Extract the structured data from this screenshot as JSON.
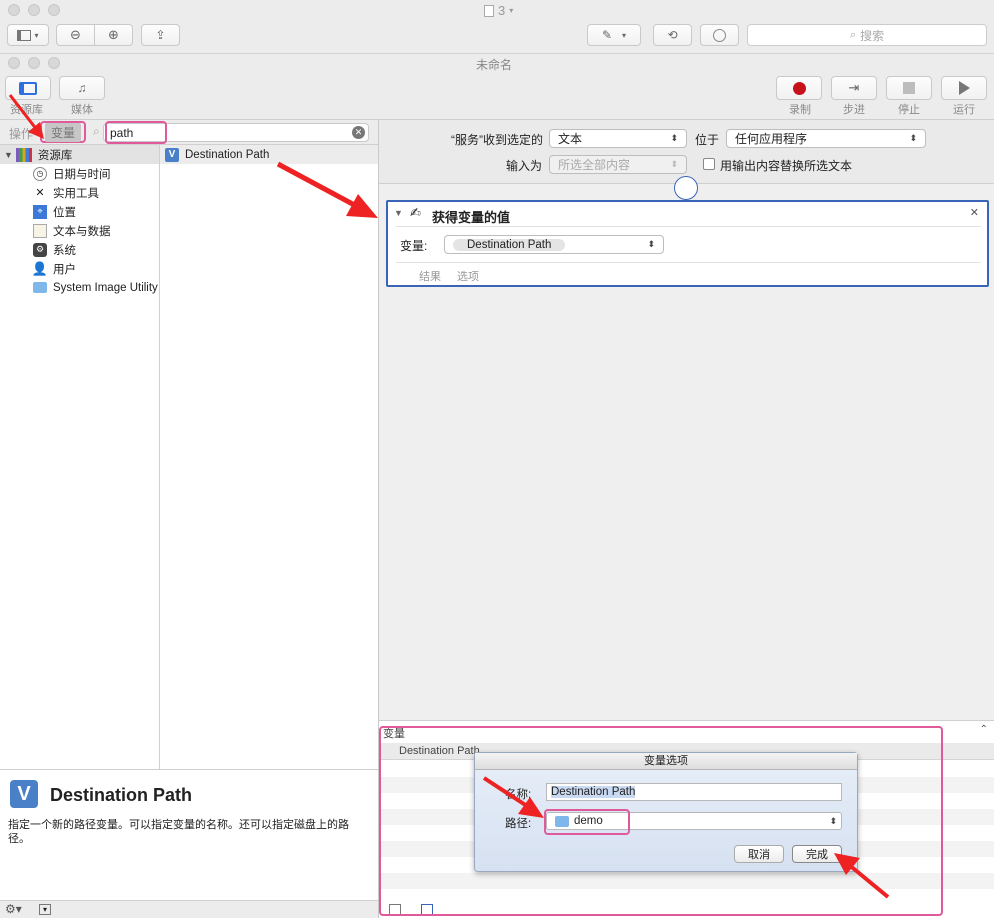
{
  "app": {
    "top_window_title": "3",
    "search_placeholder": "搜索",
    "doc_title": "未命名"
  },
  "toolbar": {
    "library_label": "资源库",
    "media_label": "媒体",
    "record_label": "录制",
    "step_label": "步进",
    "stop_label": "停止",
    "run_label": "运行",
    "record_color": "#c8101a"
  },
  "library": {
    "tab_actions": "操作",
    "tab_variables": "变量",
    "search_value": "path",
    "root": "资源库",
    "items": [
      "日期与时间",
      "实用工具",
      "位置",
      "文本与数据",
      "系统",
      "用户",
      "System Image Utility"
    ],
    "result": "Destination Path"
  },
  "description": {
    "title": "Destination Path",
    "text": "指定一个新的路径变量。可以指定变量的名称。还可以指定磁盘上的路径。"
  },
  "workflow": {
    "service_receives_label": "“服务”收到选定的",
    "input_type": "文本",
    "located_in_label": "位于",
    "app_value": "任何应用程序",
    "input_is_label": "输入为",
    "input_is_value": "所选全部内容",
    "replace_label": "用输出内容替换所选文本",
    "action_title": "获得变量的值",
    "variable_label": "变量:",
    "variable_value": "Destination Path",
    "results_tab": "结果",
    "options_tab": "选项"
  },
  "variables_panel": {
    "header": "变量",
    "column": "Destination Path"
  },
  "sheet": {
    "title": "变量选项",
    "name_label": "名称:",
    "name_value": "Destination Path",
    "path_label": "路径:",
    "path_value": "demo",
    "cancel": "取消",
    "done": "完成"
  },
  "colors": {
    "highlight": "#e05a9b",
    "arrow": "#ee2222",
    "action_border": "#3a64b8"
  }
}
